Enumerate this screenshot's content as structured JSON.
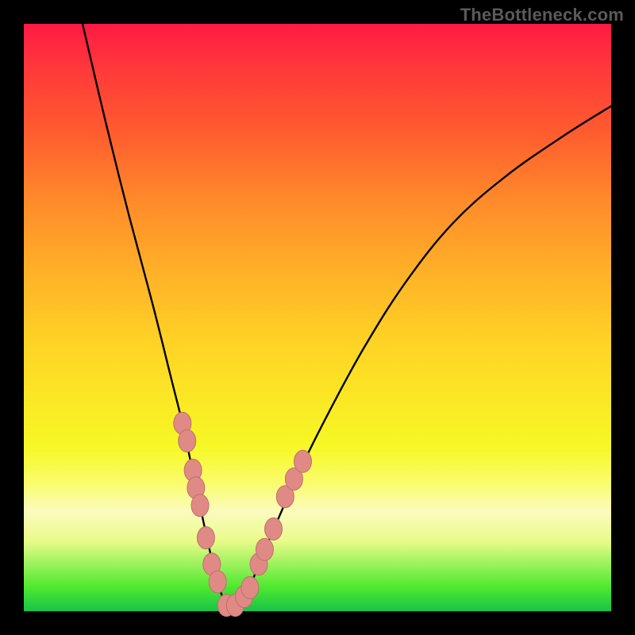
{
  "watermark": {
    "text": "TheBottleneck.com"
  },
  "colors": {
    "curve": "#000000",
    "marker_fill": "#e08a86",
    "marker_stroke": "#bf6f6b"
  },
  "chart_data": {
    "type": "line",
    "title": "",
    "xlabel": "",
    "ylabel": "",
    "xlim": [
      0,
      100
    ],
    "ylim": [
      0,
      100
    ],
    "grid": false,
    "legend": false,
    "series": [
      {
        "name": "curve",
        "x": [
          10,
          14,
          18,
          22,
          25,
          27,
          28.5,
          30,
          31.5,
          33,
          34.5,
          36,
          38,
          40,
          43,
          47,
          52,
          58,
          65,
          73,
          82,
          92,
          100
        ],
        "y": [
          100,
          83,
          67,
          52,
          40,
          32,
          25,
          18,
          11,
          5,
          1,
          1,
          3,
          8,
          15,
          24,
          34,
          45,
          56,
          66,
          74,
          81,
          86
        ]
      }
    ],
    "markers": {
      "name": "highlight-points",
      "x": [
        27.0,
        27.8,
        28.8,
        29.3,
        30.0,
        31.0,
        32.0,
        33.0,
        34.5,
        36.0,
        37.5,
        38.5,
        40.0,
        41.0,
        42.5,
        44.5,
        46.0,
        47.5
      ],
      "y": [
        32.0,
        29.0,
        24.0,
        21.0,
        18.0,
        12.5,
        8.0,
        5.0,
        1.0,
        1.0,
        2.5,
        4.0,
        8.0,
        10.5,
        14.0,
        19.5,
        22.5,
        25.5
      ]
    }
  }
}
